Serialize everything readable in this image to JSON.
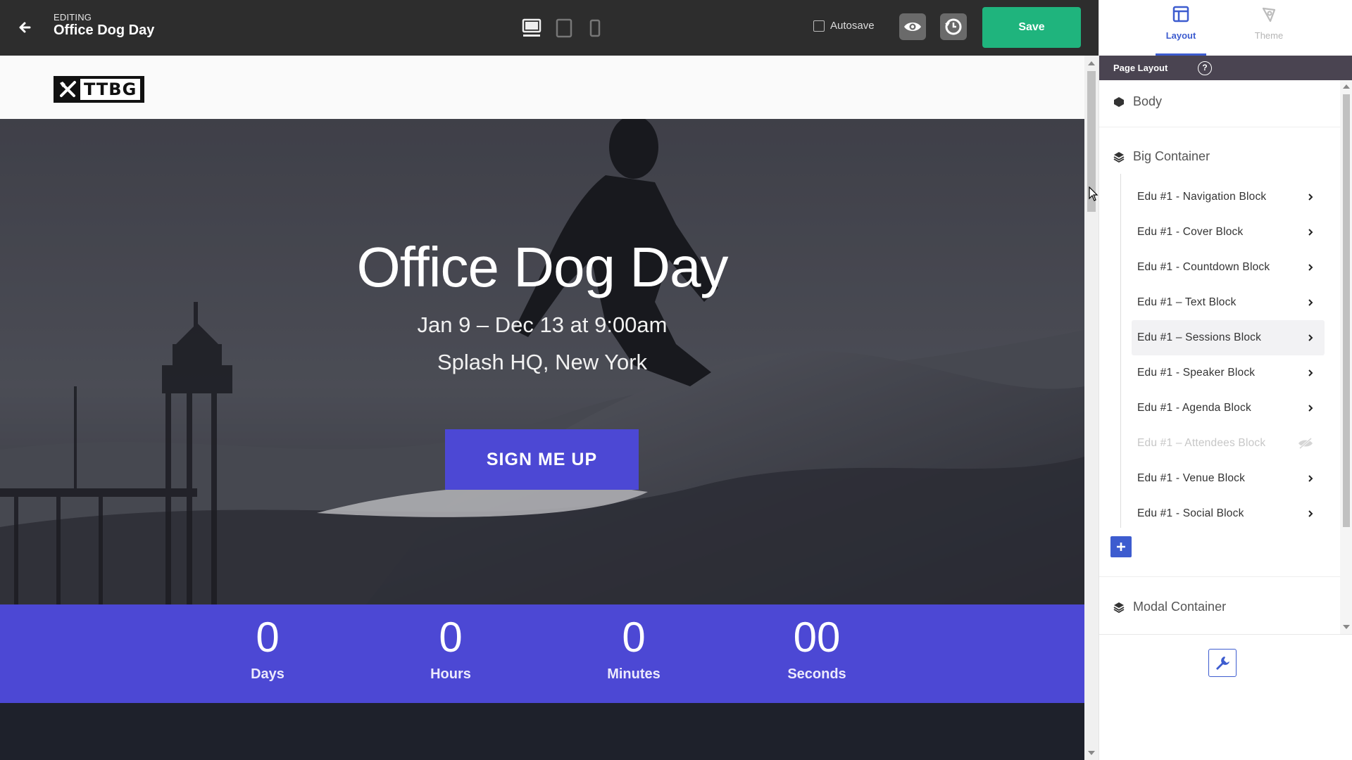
{
  "editor": {
    "editing_label": "EDITING",
    "title": "Office Dog Day",
    "autosave_label": "Autosave",
    "autosave_checked": false,
    "save_label": "Save",
    "device_modes": [
      "desktop-icon",
      "tablet-icon",
      "mobile-icon"
    ],
    "active_device": "desktop"
  },
  "site": {
    "logo_text": "TTBG",
    "hero": {
      "title": "Office Dog Day",
      "date": "Jan 9 – Dec 13 at 9:00am",
      "location": "Splash HQ, New York",
      "cta_label": "SIGN ME UP"
    },
    "countdown": [
      {
        "value": "0",
        "label": "Days"
      },
      {
        "value": "0",
        "label": "Hours"
      },
      {
        "value": "0",
        "label": "Minutes"
      },
      {
        "value": "00",
        "label": "Seconds"
      }
    ]
  },
  "panel": {
    "tabs": [
      {
        "label": "Layout",
        "icon": "layout-icon",
        "active": true
      },
      {
        "label": "Theme",
        "icon": "theme-icon",
        "active": false
      }
    ],
    "header": "Page Layout",
    "help_glyph": "?",
    "sections": {
      "body": "Body",
      "big_container": "Big Container",
      "modal_container": "Modal Container"
    },
    "blocks": [
      {
        "label": "Edu #1 - Navigation Block",
        "hidden": false
      },
      {
        "label": "Edu #1 - Cover Block",
        "hidden": false
      },
      {
        "label": "Edu #1 - Countdown Block",
        "hidden": false
      },
      {
        "label": "Edu #1 – Text Block",
        "hidden": false
      },
      {
        "label": "Edu #1 – Sessions Block",
        "hidden": false,
        "hovered": true
      },
      {
        "label": "Edu #1 - Speaker Block",
        "hidden": false
      },
      {
        "label": "Edu #1 - Agenda Block",
        "hidden": false
      },
      {
        "label": "Edu #1 – Attendees Block",
        "hidden": true
      },
      {
        "label": "Edu #1 - Venue Block",
        "hidden": false
      },
      {
        "label": "Edu #1 - Social Block",
        "hidden": false
      }
    ],
    "colors": {
      "accent": "#3d5ccf",
      "save": "#1fb47d",
      "brand_purple": "#4c48d4",
      "header_bg": "#4a4451"
    }
  }
}
